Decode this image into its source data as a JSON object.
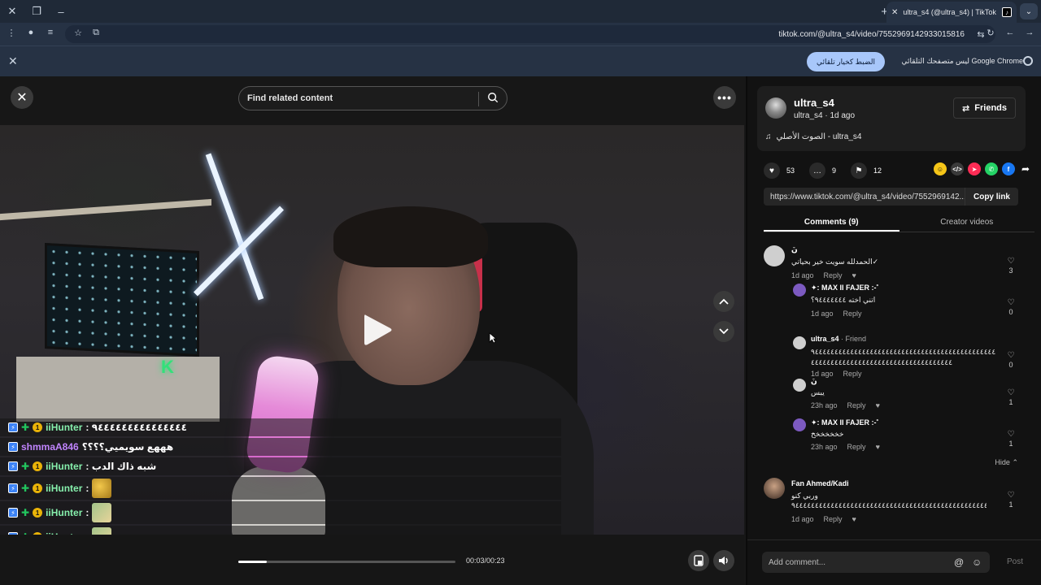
{
  "browser": {
    "tab_title": "ultra_s4 (@ultra_s4) | TikTok",
    "url": "tiktok.com/@ultra_s4/video/7552969142933015816",
    "infobar_text": "Google Chrome ليس متصفحك التلقائي",
    "infobar_button": "الضبط كخيار تلقائي"
  },
  "player": {
    "search_placeholder": "Find related content",
    "time": "00:03/00:23",
    "progress": 0.13
  },
  "chat": [
    {
      "user": "iiHunter",
      "msg": ": ٩٤٤٤٤٤٤٤٤٤٤٤٤٤٤٤",
      "color": "green",
      "emote": false
    },
    {
      "user": "shmmaA846",
      "msg": "هههع سويميي؟؟؟؟",
      "color": "purple",
      "emote": false
    },
    {
      "user": "iiHunter",
      "msg": ": شبه ذاك الدب",
      "color": "green",
      "emote": false
    },
    {
      "user": "iiHunter",
      "msg": ":",
      "color": "green",
      "emote": true
    },
    {
      "user": "iiHunter",
      "msg": ":",
      "color": "green",
      "emote": true
    },
    {
      "user": "iiHunter",
      "msg": ":",
      "color": "green",
      "emote": true
    },
    {
      "user": "iiHunter",
      "msg": ":",
      "color": "green",
      "emote": true
    }
  ],
  "author": {
    "name": "ultra_s4",
    "sub": "ultra_s4 · 1d ago",
    "friends_label": "Friends",
    "music": "الصوت الأصلي - ultra_s4"
  },
  "stats": {
    "likes": "53",
    "comments": "9",
    "saves": "12"
  },
  "share_link": {
    "url": "https://www.tiktok.com/@ultra_s4/video/7552969142...",
    "copy_label": "Copy link"
  },
  "tabs": {
    "comments": "Comments (9)",
    "creator": "Creator videos"
  },
  "comments": [
    {
      "name": "نَ",
      "text": "الحمدلله سويت خير بحياتي✓",
      "time": "1d ago",
      "reply": "Reply",
      "likes": "3"
    },
    {
      "name": "✦: MAX II FAJER :-˚",
      "text": "اتني اخته ٩٤٤٤٤٤٤٤؟",
      "time": "1d ago",
      "reply": "Reply",
      "likes": "0"
    },
    {
      "name": "ultra_s4",
      "tag": " · Friend",
      "text": "٩٤٤٤٤٤٤٤٤٤٤٤٤٤٤٤٤٤٤٤٤٤٤٤٤٤٤٤٤٤٤٤٤٤٤٤٤٤٤٤٤٤٤٤٤٤٤٤٤٤٤٤٤٤٤٤٤٤٤٤٤٤٤٤٤٤٤٤٤٤٤٤٤٤٤٤٤٤٤٤٤٤٤",
      "time": "1d ago",
      "reply": "Reply",
      "likes": "0"
    },
    {
      "name": "نَ",
      "text": "يبس",
      "time": "23h ago",
      "reply": "Reply",
      "likes": "1"
    },
    {
      "name": "✦: MAX II FAJER :-˚",
      "text": "خخخخخخخ",
      "time": "23h ago",
      "reply": "Reply",
      "likes": "1"
    },
    {
      "name": "Fan Ahmed/Kadi",
      "text": "وربي كنو",
      "text2": "٩٤٤٤٤٤٤٤٤٤٤٤٤٤٤٤٤٤٤٤٤٤٤٤٤٤٤٤٤٤٤٤٤٤٤٤٤٤٤٤٤٤٤٤٤٤٤٤٤٤٤٤٤٤٤٤٤٤٤٤٤٤",
      "time": "1d ago",
      "reply": "Reply",
      "likes": "1"
    }
  ],
  "hide_label": "Hide",
  "add_comment_placeholder": "Add comment...",
  "post_label": "Post"
}
